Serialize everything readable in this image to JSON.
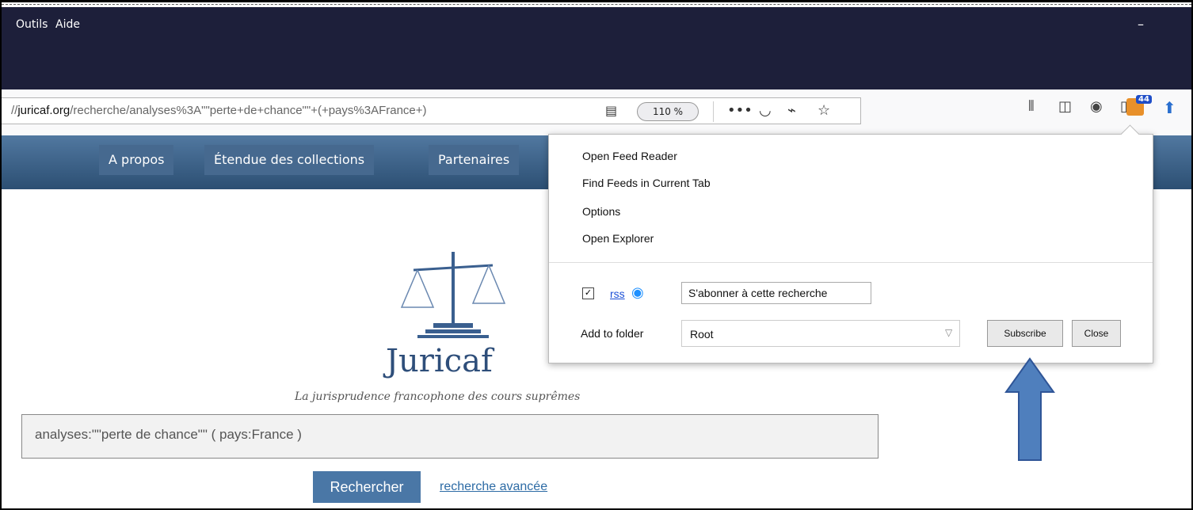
{
  "menu": {
    "outils": "Outils",
    "aide": "Aide",
    "minimize": "–"
  },
  "url": {
    "domain": "juricaf.org",
    "prefix": "//",
    "path": "/recherche/analyses%3A\"\"perte+de+chance\"\"+(+pays%3AFrance+)",
    "zoom": "110 %"
  },
  "toolbar": {
    "badge": "44"
  },
  "site_nav": [
    "A propos",
    "Étendue des collections",
    "Partenaires"
  ],
  "brand": {
    "name": "Juricaf",
    "tagline": "La jurisprudence francophone des cours suprêmes"
  },
  "search": {
    "value": "analyses:\"\"perte de chance\"\" ( pays:France )",
    "button": "Rechercher",
    "advanced": "recherche avancée"
  },
  "popup": {
    "menu": [
      "Open Feed Reader",
      "Find Feeds in Current Tab",
      "Options",
      "Open Explorer"
    ],
    "feed_label": "rss",
    "feed_title": "S'abonner à cette recherche",
    "folder_label": "Add to folder",
    "folder_value": "Root",
    "subscribe": "Subscribe",
    "close": "Close"
  },
  "colors": {
    "menubar": "#1d1f3a",
    "site_nav": "#2c4f73",
    "accent": "#4a77a6",
    "arrow": "#4f7fbd"
  }
}
